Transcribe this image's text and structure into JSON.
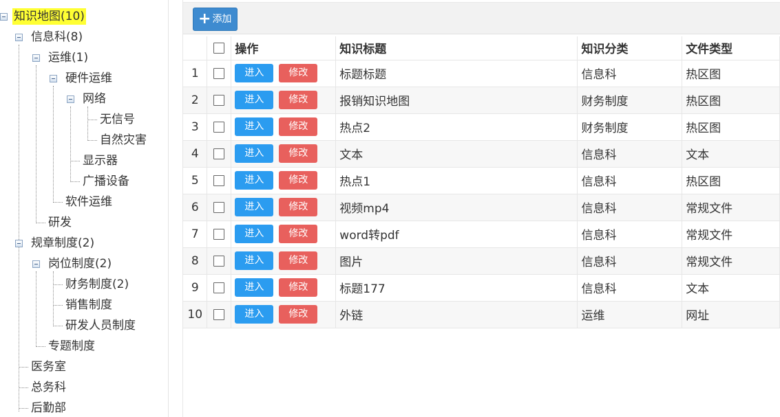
{
  "tree": {
    "nodes": [
      {
        "label": "知识地图(10)",
        "level": 0,
        "expanded": true,
        "selected": true
      },
      {
        "label": "信息科(8)",
        "level": 1,
        "expanded": true
      },
      {
        "label": "运维(1)",
        "level": 2,
        "expanded": true
      },
      {
        "label": "硬件运维",
        "level": 3,
        "expanded": true
      },
      {
        "label": "网络",
        "level": 4,
        "expanded": true
      },
      {
        "label": "无信号",
        "level": 5
      },
      {
        "label": "自然灾害",
        "level": 5
      },
      {
        "label": "显示器",
        "level": 4
      },
      {
        "label": "广播设备",
        "level": 4
      },
      {
        "label": "软件运维",
        "level": 3
      },
      {
        "label": "研发",
        "level": 2
      },
      {
        "label": "规章制度(2)",
        "level": 1,
        "expanded": true
      },
      {
        "label": "岗位制度(2)",
        "level": 2,
        "expanded": true
      },
      {
        "label": "财务制度(2)",
        "level": 3
      },
      {
        "label": "销售制度",
        "level": 3
      },
      {
        "label": "研发人员制度",
        "level": 3
      },
      {
        "label": "专题制度",
        "level": 2
      },
      {
        "label": "医务室",
        "level": 1
      },
      {
        "label": "总务科",
        "level": 1
      },
      {
        "label": "后勤部",
        "level": 1
      }
    ]
  },
  "toolbar": {
    "add_label": "添加",
    "add_icon": "plus-icon"
  },
  "table": {
    "headers": {
      "operation": "操作",
      "title": "知识标题",
      "category": "知识分类",
      "file_type": "文件类型"
    },
    "enter_label": "进入",
    "edit_label": "修改",
    "rows": [
      {
        "num": "1",
        "title": "标题标题",
        "category": "信息科",
        "file_type": "热区图"
      },
      {
        "num": "2",
        "title": "报销知识地图",
        "category": "财务制度",
        "file_type": "热区图"
      },
      {
        "num": "3",
        "title": "热点2",
        "category": "财务制度",
        "file_type": "热区图"
      },
      {
        "num": "4",
        "title": "文本",
        "category": "信息科",
        "file_type": "文本"
      },
      {
        "num": "5",
        "title": "热点1",
        "category": "信息科",
        "file_type": "热区图"
      },
      {
        "num": "6",
        "title": "视频mp4",
        "category": "信息科",
        "file_type": "常规文件"
      },
      {
        "num": "7",
        "title": "word转pdf",
        "category": "信息科",
        "file_type": "常规文件"
      },
      {
        "num": "8",
        "title": "图片",
        "category": "信息科",
        "file_type": "常规文件"
      },
      {
        "num": "9",
        "title": "标题177",
        "category": "信息科",
        "file_type": "文本"
      },
      {
        "num": "10",
        "title": "外链",
        "category": "运维",
        "file_type": "网址"
      }
    ]
  },
  "colors": {
    "selected_highlight": "#ffff33",
    "enter_button": "#2b9cf0",
    "edit_button": "#e8605d",
    "add_button": "#3e8bd0"
  }
}
